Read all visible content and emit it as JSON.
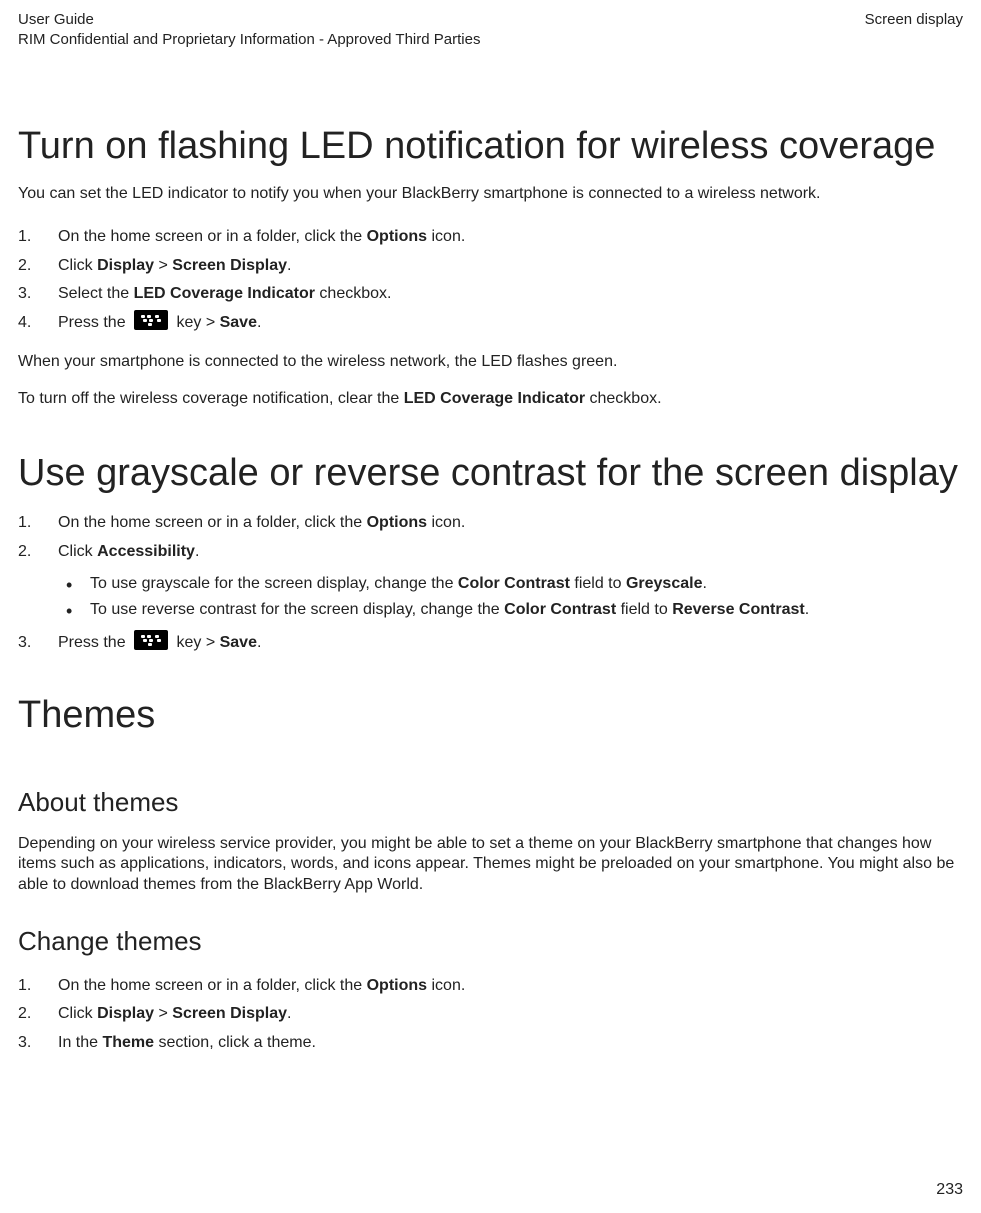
{
  "header": {
    "left_line1": "User Guide",
    "left_line2": "RIM Confidential and Proprietary Information - Approved Third Parties",
    "right": "Screen display"
  },
  "section1": {
    "title": "Turn on flashing LED notification for wireless coverage",
    "intro": "You can set the LED indicator to notify you when your BlackBerry smartphone is connected to a wireless network.",
    "step1_a": "On the home screen or in a folder, click the ",
    "step1_b": "Options",
    "step1_c": " icon.",
    "step2_a": "Click ",
    "step2_b": "Display",
    "step2_c": " > ",
    "step2_d": "Screen Display",
    "step2_e": ".",
    "step3_a": "Select the ",
    "step3_b": "LED Coverage Indicator",
    "step3_c": " checkbox.",
    "step4_a": "Press the ",
    "step4_b": " key > ",
    "step4_c": "Save",
    "step4_d": ".",
    "para1": "When your smartphone is connected to the wireless network, the LED flashes green.",
    "para2_a": "To turn off the wireless coverage notification, clear the ",
    "para2_b": "LED Coverage Indicator",
    "para2_c": " checkbox."
  },
  "section2": {
    "title": "Use grayscale or reverse contrast for the screen display",
    "step1_a": "On the home screen or in a folder, click the ",
    "step1_b": "Options",
    "step1_c": " icon.",
    "step2_a": "Click ",
    "step2_b": "Accessibility",
    "step2_c": ".",
    "bullet1_a": "To use grayscale for the screen display, change the ",
    "bullet1_b": "Color Contrast",
    "bullet1_c": " field to ",
    "bullet1_d": "Greyscale",
    "bullet1_e": ".",
    "bullet2_a": "To use reverse contrast for the screen display, change the ",
    "bullet2_b": "Color Contrast",
    "bullet2_c": " field to ",
    "bullet2_d": "Reverse Contrast",
    "bullet2_e": ".",
    "step3_a": "Press the ",
    "step3_b": " key > ",
    "step3_c": "Save",
    "step3_d": "."
  },
  "section3": {
    "title": "Themes",
    "sub1_title": "About themes",
    "sub1_para": "Depending on your wireless service provider, you might be able to set a theme on your BlackBerry smartphone that changes how items such as applications, indicators, words, and icons appear. Themes might be preloaded on your smartphone. You might also be able to download themes from the BlackBerry App World.",
    "sub2_title": "Change themes",
    "s2step1_a": "On the home screen or in a folder, click the ",
    "s2step1_b": "Options",
    "s2step1_c": " icon.",
    "s2step2_a": "Click ",
    "s2step2_b": "Display",
    "s2step2_c": " > ",
    "s2step2_d": "Screen Display",
    "s2step2_e": ".",
    "s2step3_a": "In the ",
    "s2step3_b": "Theme",
    "s2step3_c": " section, click a theme."
  },
  "page_number": "233"
}
